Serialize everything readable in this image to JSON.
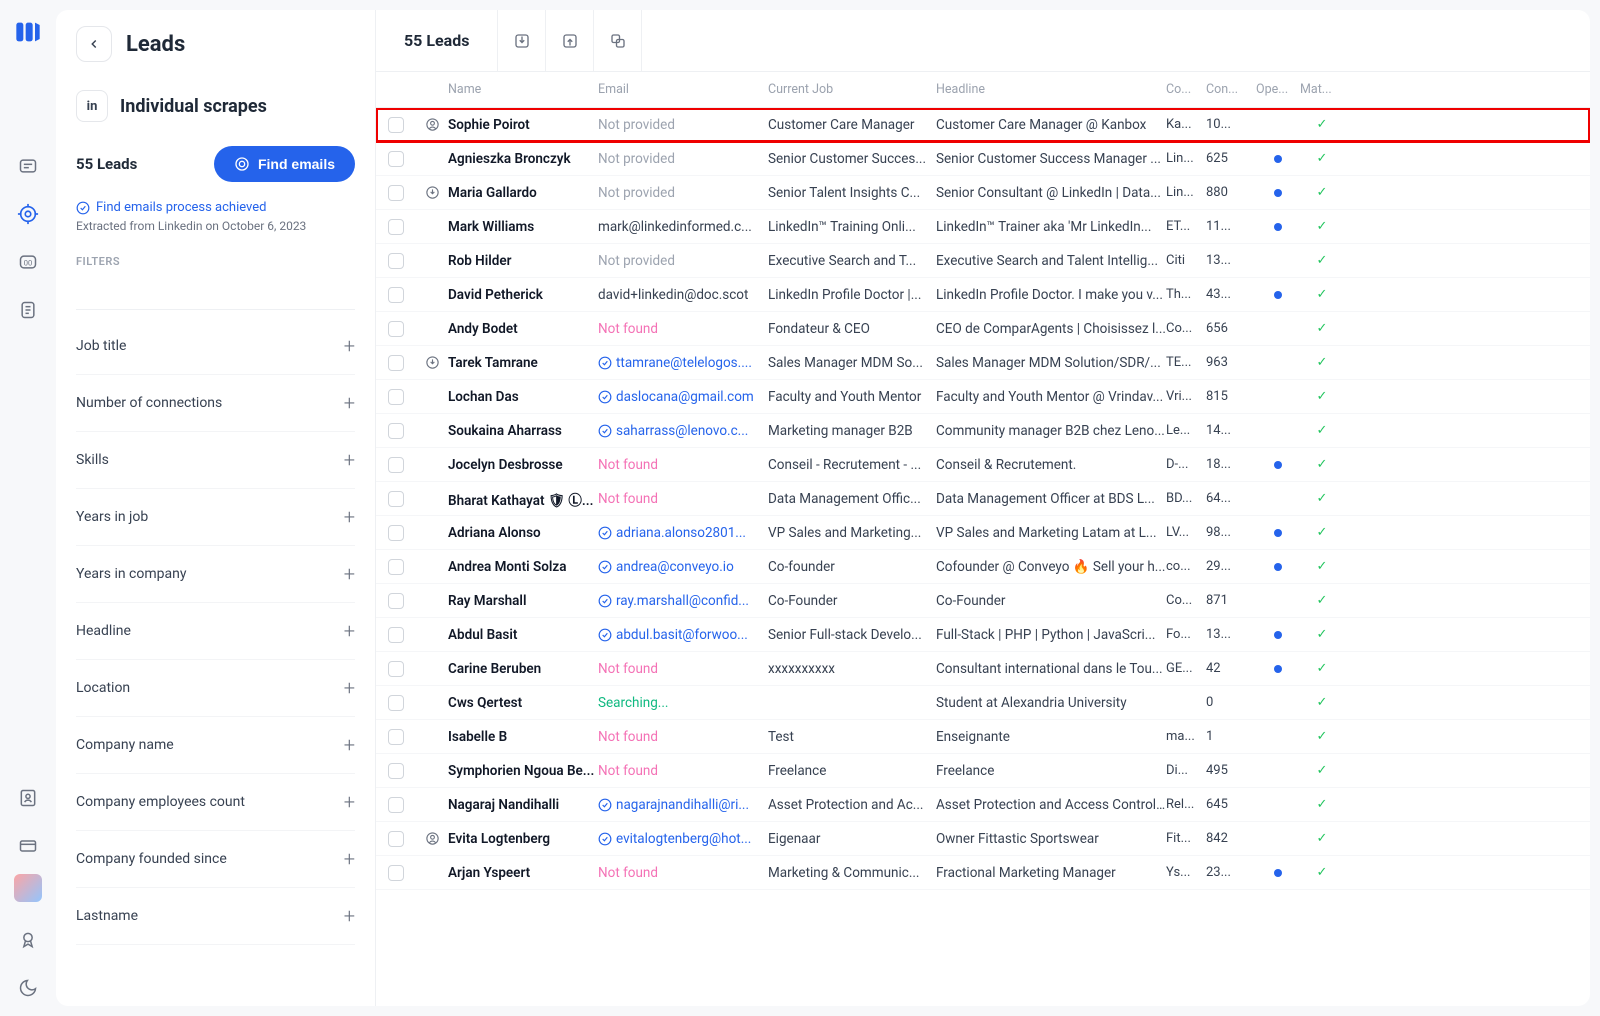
{
  "page_title": "Leads",
  "crumb": "Individual scrapes",
  "lead_count": "55 Leads",
  "find_emails_label": "Find emails",
  "status_line": "Find emails process achieved",
  "status_sub": "Extracted from Linkedin on October 6, 2023",
  "filters_label": "FILTERS",
  "filters": [
    "Job title",
    "Number of connections",
    "Skills",
    "Years in job",
    "Years in company",
    "Headline",
    "Location",
    "Company name",
    "Company employees count",
    "Company founded since",
    "Lastname"
  ],
  "topbar_title": "55 Leads",
  "columns": [
    "",
    "",
    "Name",
    "Email",
    "Current Job",
    "Headline",
    "Co...",
    "Con...",
    "Ope...",
    "Mat..."
  ],
  "rows": [
    {
      "hl": true,
      "badge": "person",
      "name": "Sophie Poirot",
      "email": "Not provided",
      "etype": "muted",
      "job": "Customer Care Manager",
      "headline": "Customer Care Manager @ Kanbox",
      "co": "Ka...",
      "con": "10...",
      "open": false,
      "match": true
    },
    {
      "badge": "",
      "name": "Agnieszka Bronczyk",
      "email": "Not provided",
      "etype": "muted",
      "job": "Senior Customer Succes...",
      "headline": "Senior Customer Success Manager ...",
      "co": "Lin...",
      "con": "625",
      "open": true,
      "match": true
    },
    {
      "badge": "down",
      "name": "Maria Gallardo",
      "email": "Not provided",
      "etype": "muted",
      "job": "Senior Talent Insights C...",
      "headline": "Senior Consultant @ LinkedIn | Data...",
      "co": "Lin...",
      "con": "880",
      "open": true,
      "match": true
    },
    {
      "badge": "",
      "name": "Mark Williams",
      "email": "mark@linkedinformed.c...",
      "etype": "txt",
      "job": "LinkedIn™ Training Onli...",
      "headline": "LinkedIn™ Trainer aka 'Mr LinkedIn...",
      "co": "ET...",
      "con": "11...",
      "open": true,
      "match": true
    },
    {
      "badge": "",
      "name": "Rob Hilder",
      "email": "Not provided",
      "etype": "muted",
      "job": "Executive Search and T...",
      "headline": "Executive Search and Talent Intellig...",
      "co": "Citi",
      "con": "13...",
      "open": false,
      "match": true
    },
    {
      "badge": "",
      "name": "David Petherick",
      "email": "david+linkedin@doc.scot",
      "etype": "txt",
      "job": "LinkedIn Profile Doctor |...",
      "headline": "LinkedIn Profile Doctor. I make you v...",
      "co": "Th...",
      "con": "43...",
      "open": true,
      "match": true
    },
    {
      "badge": "",
      "name": "Andy Bodet",
      "email": "Not found",
      "etype": "nf",
      "job": "Fondateur & CEO",
      "headline": "CEO de ComparAgents | Choisissez l...",
      "co": "Co...",
      "con": "656",
      "open": false,
      "match": true
    },
    {
      "badge": "down",
      "name": "Tarek Tamrane",
      "email": "ttamrane@telelogos....",
      "etype": "em",
      "job": "Sales Manager MDM So...",
      "headline": "Sales Manager MDM Solution/SDR/...",
      "co": "TE...",
      "con": "963",
      "open": false,
      "match": true
    },
    {
      "badge": "",
      "name": "Lochan Das",
      "email": "daslocana@gmail.com",
      "etype": "em",
      "job": "Faculty and Youth Mentor",
      "headline": "Faculty and Youth Mentor @ Vrindav...",
      "co": "Vri...",
      "con": "815",
      "open": false,
      "match": true
    },
    {
      "badge": "",
      "name": "Soukaina Aharrass",
      "email": "saharrass@lenovo.c...",
      "etype": "em",
      "job": "Marketing manager B2B",
      "headline": "Community manager B2B chez Leno...",
      "co": "Le...",
      "con": "14...",
      "open": false,
      "match": true
    },
    {
      "badge": "",
      "name": "Jocelyn Desbrosse",
      "email": "Not found",
      "etype": "nf",
      "job": "Conseil - Recrutement - ...",
      "headline": "Conseil & Recrutement.",
      "co": "D-...",
      "con": "18...",
      "open": true,
      "match": true
    },
    {
      "badge": "",
      "name": "Bharat Kathayat 🛡 Ⓛ...",
      "email": "Not found",
      "etype": "nf",
      "job": "Data Management Offic...",
      "headline": "Data Management Officer at BDS L...",
      "co": "BD...",
      "con": "64...",
      "open": false,
      "match": true
    },
    {
      "badge": "",
      "name": "Adriana Alonso",
      "email": "adriana.alonso2801...",
      "etype": "em",
      "job": "VP Sales and Marketing...",
      "headline": "VP Sales and Marketing Latam at L...",
      "co": "LV...",
      "con": "98...",
      "open": true,
      "match": true
    },
    {
      "badge": "",
      "name": "Andrea Monti Solza",
      "email": "andrea@conveyo.io",
      "etype": "em",
      "job": "Co-founder",
      "headline": "Cofounder @ Conveyo 🔥 Sell your h...",
      "co": "co...",
      "con": "29...",
      "open": true,
      "match": true
    },
    {
      "badge": "",
      "name": "Ray Marshall",
      "email": "ray.marshall@confid...",
      "etype": "em",
      "job": "Co-Founder",
      "headline": "Co-Founder",
      "co": "Co...",
      "con": "871",
      "open": false,
      "match": true
    },
    {
      "badge": "",
      "name": "Abdul Basit",
      "email": "abdul.basit@forwoo...",
      "etype": "em",
      "job": "Senior Full-stack Develo...",
      "headline": "Full-Stack | PHP | Python | JavaScri...",
      "co": "Fo...",
      "con": "13...",
      "open": true,
      "match": true
    },
    {
      "badge": "",
      "name": "Carine Beruben",
      "email": "Not found",
      "etype": "nf",
      "job": "xxxxxxxxxx",
      "headline": "Consultant international dans le Tou...",
      "co": "GE...",
      "con": "42",
      "open": true,
      "match": true
    },
    {
      "badge": "",
      "name": "Cws Qertest",
      "email": "Searching...",
      "etype": "srch",
      "job": "",
      "headline": "Student at Alexandria University",
      "co": "",
      "con": "0",
      "open": false,
      "match": true
    },
    {
      "badge": "",
      "name": "Isabelle B",
      "email": "Not found",
      "etype": "nf",
      "job": "Test",
      "headline": "Enseignante",
      "co": "ma...",
      "con": "1",
      "open": false,
      "match": true
    },
    {
      "badge": "",
      "name": "Symphorien Ngoua Be...",
      "email": "Not found",
      "etype": "nf",
      "job": "Freelance",
      "headline": "Freelance",
      "co": "Di...",
      "con": "495",
      "open": false,
      "match": true
    },
    {
      "badge": "",
      "name": "Nagaraj Nandihalli",
      "email": "nagarajnandihalli@ri...",
      "etype": "em",
      "job": "Asset Protection and Ac...",
      "headline": "Asset Protection and Access Control...",
      "co": "Rel...",
      "con": "645",
      "open": false,
      "match": true
    },
    {
      "badge": "person",
      "name": "Evita Logtenberg",
      "email": "evitalogtenberg@hot...",
      "etype": "em",
      "job": "Eigenaar",
      "headline": "Owner Fittastic Sportswear",
      "co": "Fit...",
      "con": "842",
      "open": false,
      "match": true
    },
    {
      "badge": "",
      "name": "Arjan Yspeert",
      "email": "Not found",
      "etype": "nf",
      "job": "Marketing & Communic...",
      "headline": "Fractional Marketing Manager",
      "co": "Ys...",
      "con": "23...",
      "open": true,
      "match": true
    }
  ]
}
